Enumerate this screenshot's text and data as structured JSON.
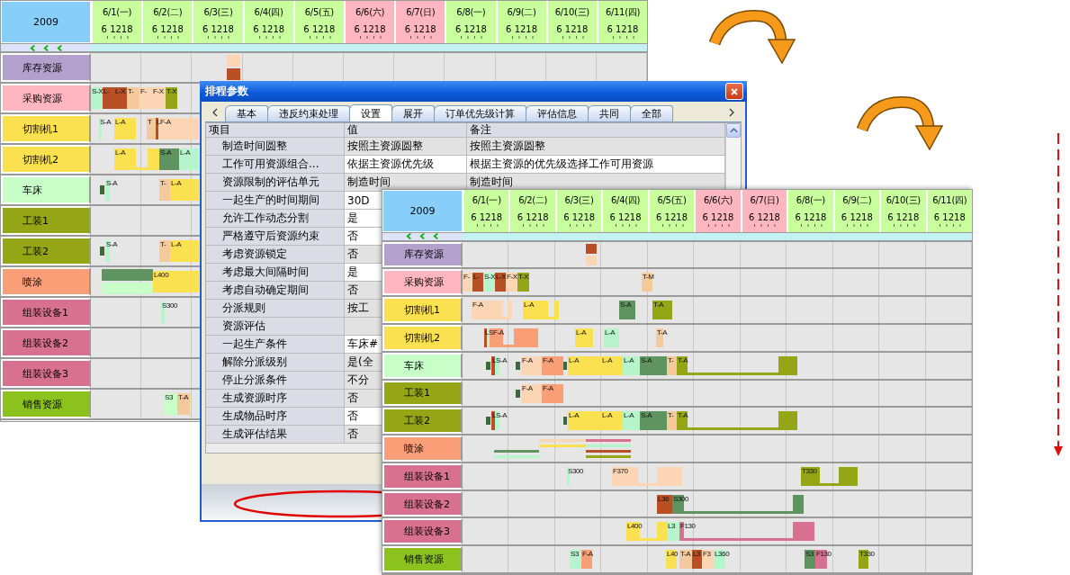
{
  "schedule_views": [
    {
      "year": "2009",
      "days": [
        {
          "label": "6/1(一)",
          "ticks": "6 1218",
          "weekend": false
        },
        {
          "label": "6/2(二)",
          "ticks": "6 1218",
          "weekend": false
        },
        {
          "label": "6/3(三)",
          "ticks": "6 1218",
          "weekend": false
        },
        {
          "label": "6/4(四)",
          "ticks": "6 1218",
          "weekend": false
        },
        {
          "label": "6/5(五)",
          "ticks": "6 1218",
          "weekend": false
        },
        {
          "label": "6/6(六)",
          "ticks": "6 1218",
          "weekend": true
        },
        {
          "label": "6/7(日)",
          "ticks": "6 1218",
          "weekend": true
        },
        {
          "label": "6/8(一)",
          "ticks": "6 1218",
          "weekend": false
        },
        {
          "label": "6/9(二)",
          "ticks": "6 1218",
          "weekend": false
        },
        {
          "label": "6/10(三)",
          "ticks": "6 1218",
          "weekend": false
        },
        {
          "label": "6/11(四)",
          "ticks": "6 1218",
          "weekend": false
        }
      ],
      "rows": [
        {
          "name": "库存资源",
          "color": "#b3a0cc",
          "bars": [
            {
              "color": "#fcd5b4"
            },
            {
              "color": "#b84f25"
            }
          ]
        },
        {
          "name": "采购资源",
          "color": "#ffb6c1",
          "bars": [
            {
              "label": "S-X",
              "color": "#b6f5cc"
            },
            {
              "label": "L-",
              "color": "#b84f25"
            },
            {
              "label": "L-X",
              "color": "#b84f25"
            },
            {
              "label": "T-",
              "color": "#f6c99c"
            },
            {
              "label": "F-",
              "color": "#fcd5b4"
            },
            {
              "label": "F-X",
              "color": "#fcd5b4"
            },
            {
              "label": "T-X",
              "color": "#94a615"
            }
          ]
        },
        {
          "name": "切割机1",
          "color": "#fbe050",
          "bars": [
            {
              "label": "S-A",
              "color": "#b6f5cc"
            },
            {
              "label": "L-A",
              "color": "#fbe050"
            },
            {
              "label": "T",
              "color": "#f6c99c"
            },
            {
              "label": "LF-A",
              "color": "#b84f25"
            },
            {
              "color": "#fcd5b4"
            }
          ]
        },
        {
          "name": "切割机2",
          "color": "#fbe050",
          "bars": [
            {
              "label": "L-A",
              "color": "#fbe050"
            },
            {
              "label": "S-A",
              "color": "#5f9460"
            },
            {
              "label": "L-A",
              "color": "#b6f5cc"
            }
          ]
        },
        {
          "name": "车床",
          "color": "#c8ffc8",
          "bars": [
            {
              "color": "#3a6b3a"
            },
            {
              "label": "S-A",
              "color": "#b6f5cc"
            },
            {
              "label": "T-",
              "color": "#f6c99c"
            },
            {
              "label": "L-A",
              "color": "#fbe050"
            }
          ]
        },
        {
          "name": "工装1",
          "color": "#94a615",
          "bars": []
        },
        {
          "name": "工装2",
          "color": "#94a615",
          "bars": [
            {
              "color": "#3a6b3a"
            },
            {
              "label": "S-A",
              "color": "#b6f5cc"
            },
            {
              "label": "T-",
              "color": "#f6c99c"
            },
            {
              "label": "L-A",
              "color": "#fbe050"
            }
          ]
        },
        {
          "name": "喷涂",
          "color": "#fa9e78",
          "bars": [
            {
              "color": "#5f9460"
            },
            {
              "color": "#c8ffc8"
            },
            {
              "label": "L400",
              "color": "#fbe050"
            }
          ]
        },
        {
          "name": "组装设备1",
          "color": "#d8708f",
          "bars": [
            {
              "label": "S300",
              "color": "#b6f5cc"
            }
          ]
        },
        {
          "name": "组装设备2",
          "color": "#d8708f",
          "bars": []
        },
        {
          "name": "组装设备3",
          "color": "#d8708f",
          "bars": []
        },
        {
          "name": "销售资源",
          "color": "#8cc21e",
          "bars": [
            {
              "label": "S3",
              "color": "#c8ffc8"
            },
            {
              "label": "T-A",
              "color": "#f6c99c"
            }
          ]
        }
      ]
    },
    {
      "year": "2009",
      "days": [
        {
          "label": "6/1(一)",
          "ticks": "6 1218",
          "weekend": false
        },
        {
          "label": "6/2(二)",
          "ticks": "6 1218",
          "weekend": false
        },
        {
          "label": "6/3(三)",
          "ticks": "6 1218",
          "weekend": false
        },
        {
          "label": "6/4(四)",
          "ticks": "6 1218",
          "weekend": false
        },
        {
          "label": "6/5(五)",
          "ticks": "6 1218",
          "weekend": false
        },
        {
          "label": "6/6(六)",
          "ticks": "6 1218",
          "weekend": true
        },
        {
          "label": "6/7(日)",
          "ticks": "6 1218",
          "weekend": true
        },
        {
          "label": "6/8(一)",
          "ticks": "6 1218",
          "weekend": false
        },
        {
          "label": "6/9(二)",
          "ticks": "6 1218",
          "weekend": false
        },
        {
          "label": "6/10(三)",
          "ticks": "6 1218",
          "weekend": false
        },
        {
          "label": "6/11(四)",
          "ticks": "6 1218",
          "weekend": false
        }
      ],
      "rows": [
        {
          "name": "库存资源",
          "color": "#b3a0cc",
          "bars": [
            {
              "color": "#b84f25"
            },
            {
              "color": "#fcd5b4"
            }
          ]
        },
        {
          "name": "采购资源",
          "color": "#ffb6c1",
          "bars": [
            {
              "label": "F-",
              "color": "#fcd5b4"
            },
            {
              "label": "L-",
              "color": "#b84f25"
            },
            {
              "label": "S-X",
              "color": "#b6f5cc"
            },
            {
              "label": "L-X",
              "color": "#b84f25"
            },
            {
              "label": "F-X",
              "color": "#fcd5b4"
            },
            {
              "label": "T-X",
              "color": "#94a615"
            },
            {
              "label": "T-M",
              "color": "#f6c99c"
            }
          ]
        },
        {
          "name": "切割机1",
          "color": "#fbe050",
          "bars": [
            {
              "label": "F-A",
              "color": "#fcd5b4"
            },
            {
              "label": "L-A",
              "color": "#fbe050"
            },
            {
              "label": "S-A",
              "color": "#5f9460"
            },
            {
              "label": "T-A",
              "color": "#94a615"
            }
          ]
        },
        {
          "name": "切割机2",
          "color": "#fbe050",
          "bars": [
            {
              "label": "LSF-A",
              "color": "#b84f25"
            },
            {
              "color": "#b6f5cc"
            },
            {
              "color": "#fa9e78"
            },
            {
              "label": "L-A",
              "color": "#fbe050"
            },
            {
              "label": "L-A",
              "color": "#b6f5cc"
            },
            {
              "label": "T-A",
              "color": "#f6c99c"
            }
          ]
        },
        {
          "name": "车床",
          "color": "#c8ffc8",
          "bars": [
            {
              "color": "#3a6b3a"
            },
            {
              "label": "LS-A",
              "color": "#b84f25"
            },
            {
              "color": "#b6f5cc"
            },
            {
              "color": "#3a6b3a"
            },
            {
              "label": "F-A",
              "color": "#fcd5b4"
            },
            {
              "label": "F-A",
              "color": "#fa9e78"
            },
            {
              "color": "#3a6b3a"
            },
            {
              "label": "L-A",
              "color": "#fbe050"
            },
            {
              "label": "L-A",
              "color": "#fbe050"
            },
            {
              "label": "L-A",
              "color": "#b6f5cc"
            },
            {
              "label": "S-A",
              "color": "#5f9460"
            },
            {
              "label": "T-",
              "color": "#f6c99c"
            },
            {
              "label": "T-A",
              "color": "#94a615"
            }
          ]
        },
        {
          "name": "工装1",
          "color": "#94a615",
          "bars": [
            {
              "color": "#3a6b3a"
            },
            {
              "label": "F-A",
              "color": "#fcd5b4"
            },
            {
              "label": "F-A",
              "color": "#fa9e78"
            }
          ]
        },
        {
          "name": "工装2",
          "color": "#94a615",
          "bars": [
            {
              "color": "#3a6b3a"
            },
            {
              "label": "LS-A",
              "color": "#b84f25"
            },
            {
              "color": "#b6f5cc"
            },
            {
              "color": "#3a6b3a"
            },
            {
              "label": "L-A",
              "color": "#fbe050"
            },
            {
              "label": "L-A",
              "color": "#fbe050"
            },
            {
              "label": "L-A",
              "color": "#b6f5cc"
            },
            {
              "label": "S-A",
              "color": "#5f9460"
            },
            {
              "label": "T-",
              "color": "#f6c99c"
            },
            {
              "label": "T-A",
              "color": "#94a615"
            }
          ]
        },
        {
          "name": "喷涂",
          "color": "#fa9e78",
          "bars": [
            {
              "color": "#fcd5b4"
            },
            {
              "color": "#d8708f"
            },
            {
              "color": "#fbe050"
            },
            {
              "color": "#b6f5cc"
            },
            {
              "color": "#5f9460"
            },
            {
              "color": "#b84f25"
            },
            {
              "color": "#b6f5cc"
            },
            {
              "color": "#94a615"
            }
          ]
        },
        {
          "name": "组装设备1",
          "color": "#d8708f",
          "bars": [
            {
              "label": "S300",
              "color": "#b6f5cc"
            },
            {
              "label": "F370",
              "color": "#fcd5b4"
            },
            {
              "label": "T330",
              "color": "#94a615"
            }
          ]
        },
        {
          "name": "组装设备2",
          "color": "#d8708f",
          "bars": [
            {
              "label": "L36",
              "color": "#b84f25"
            },
            {
              "label": "S300",
              "color": "#5f9460"
            }
          ]
        },
        {
          "name": "组装设备3",
          "color": "#d8708f",
          "bars": [
            {
              "label": "L400",
              "color": "#fbe050"
            },
            {
              "label": "L3",
              "color": "#b6f5cc"
            },
            {
              "label": "F130",
              "color": "#d8708f"
            }
          ]
        },
        {
          "name": "销售资源",
          "color": "#8cc21e",
          "bars": [
            {
              "label": "S3",
              "color": "#b6f5cc"
            },
            {
              "label": "F-A",
              "color": "#fa9e78"
            },
            {
              "label": "L40",
              "color": "#fbe050"
            },
            {
              "label": "T-A",
              "color": "#f6c99c"
            },
            {
              "label": "L3",
              "color": "#b84f25"
            },
            {
              "label": "F3",
              "color": "#fcd5b4"
            },
            {
              "label": "L360",
              "color": "#b6f5cc"
            },
            {
              "label": "S3",
              "color": "#5f9460"
            },
            {
              "label": "F130",
              "color": "#d8708f"
            },
            {
              "label": "T330",
              "color": "#94a615"
            }
          ]
        }
      ]
    }
  ],
  "dialog": {
    "title": "排程参数",
    "tabs": [
      {
        "label": "基本",
        "selected": false
      },
      {
        "label": "违反约束处理",
        "selected": false
      },
      {
        "label": "设置",
        "selected": true
      },
      {
        "label": "展开",
        "selected": false
      },
      {
        "label": "订单优先级计算",
        "selected": false
      },
      {
        "label": "评估信息",
        "selected": false
      },
      {
        "label": "共同",
        "selected": false
      },
      {
        "label": "全部",
        "selected": false
      }
    ],
    "columns": [
      "项目",
      "值",
      "备注"
    ],
    "rows": [
      {
        "item": "制造时间圆整",
        "value": "按照主资源圆整",
        "note": "按照主资源圆整",
        "editable": false
      },
      {
        "item": "工作可用资源组合...",
        "value": "依据主资源优先级",
        "note": "根据主资源的优先级选择工作可用资源",
        "editable": true
      },
      {
        "item": "资源限制的评估单元",
        "value": "制造时间",
        "note": "制造时间",
        "editable": false
      },
      {
        "item": "一起生产的时间期间",
        "value": "30D",
        "editable": true
      },
      {
        "item": "允许工作动态分割",
        "value": "是",
        "editable": true
      },
      {
        "item": "严格遵守后资源约束",
        "value": "否",
        "editable": true
      },
      {
        "item": "考虑资源锁定",
        "value": "否",
        "editable": false
      },
      {
        "item": "考虑最大间隔时间",
        "value": "是",
        "editable": true
      },
      {
        "item": "考虑自动确定期间",
        "value": "否",
        "editable": false
      },
      {
        "item": "分派规则",
        "value": "按工",
        "editable": false
      },
      {
        "item": "资源评估",
        "editable": false
      },
      {
        "item": "一起生产条件",
        "value": "车床#",
        "editable": true
      },
      {
        "item": "解除分派级别",
        "value": "是(全",
        "editable": false
      },
      {
        "item": "停止分派条件",
        "value": "不分",
        "editable": false
      },
      {
        "item": "生成资源时序",
        "value": "否",
        "editable": false
      },
      {
        "item": "生成物品时序",
        "value": "否",
        "editable": true
      },
      {
        "item": "生成评估结果",
        "value": "否",
        "editable": false
      }
    ]
  }
}
